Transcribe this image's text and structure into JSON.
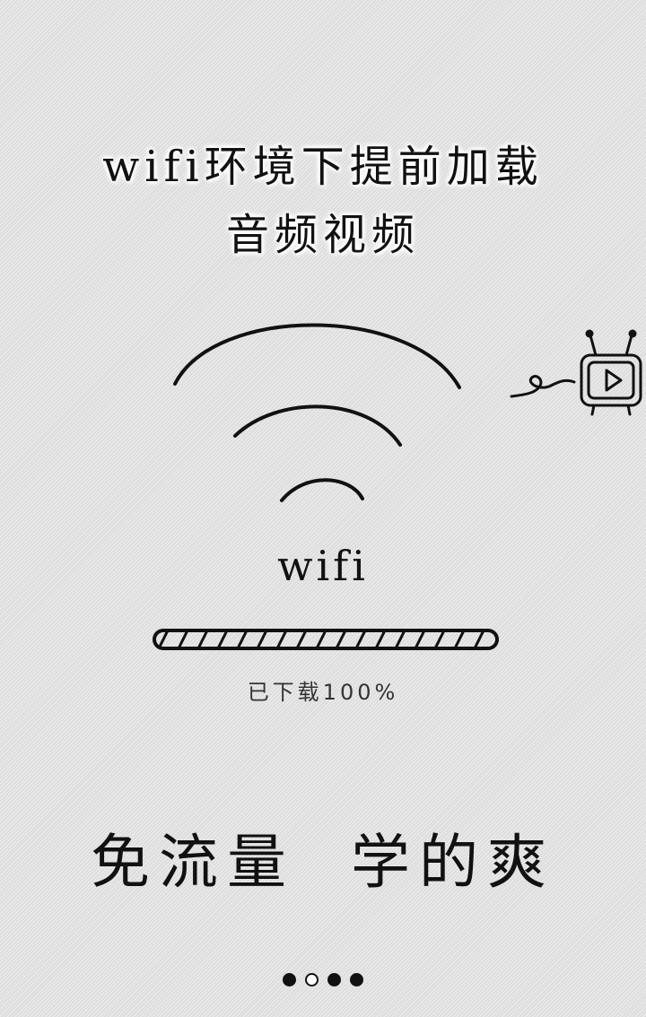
{
  "intro": {
    "title_line_1": "wifi环境下提前加载",
    "title_line_2": "音频视频",
    "network_label": "wifi",
    "progress": {
      "text": "已下载100%",
      "value": 100
    },
    "slogan": "免流量  学的爽"
  },
  "pager": {
    "count": 4,
    "active_index": 1
  },
  "icons": [
    "wifi-signal-icon",
    "tv-play-icon"
  ],
  "colors": {
    "ink": "#111111",
    "background": "#e4e4e4"
  }
}
